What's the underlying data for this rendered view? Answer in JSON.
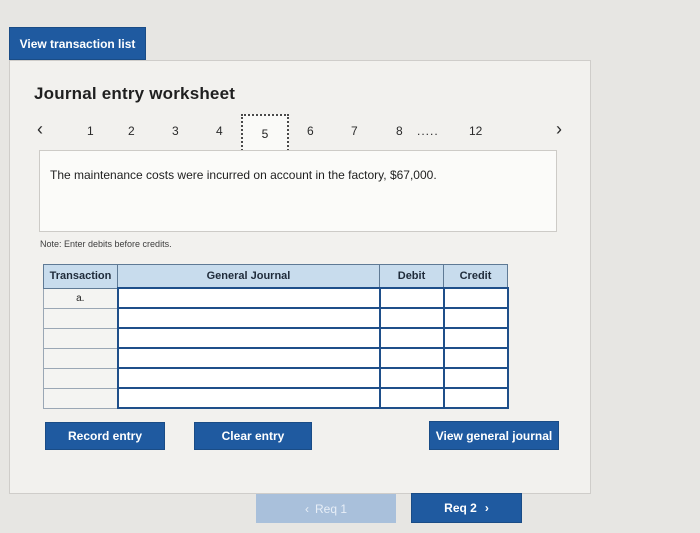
{
  "top_button": {
    "label": "View transaction list"
  },
  "worksheet": {
    "title": "Journal entry worksheet",
    "nav": {
      "items": [
        "1",
        "2",
        "3",
        "4",
        "5",
        "6",
        "7",
        "8",
        "12"
      ],
      "current": "5",
      "ellipsis": "....."
    },
    "description": "The maintenance costs were incurred on account in the factory, $67,000.",
    "note": "Note: Enter debits before credits.",
    "table": {
      "headers": [
        "Transaction",
        "General Journal",
        "Debit",
        "Credit"
      ],
      "rows": [
        [
          "a.",
          "",
          "",
          ""
        ],
        [
          "",
          "",
          "",
          ""
        ],
        [
          "",
          "",
          "",
          ""
        ],
        [
          "",
          "",
          "",
          ""
        ],
        [
          "",
          "",
          "",
          ""
        ],
        [
          "",
          "",
          "",
          ""
        ]
      ]
    },
    "buttons": {
      "record": "Record entry",
      "clear": "Clear entry",
      "view_journal": "View general journal"
    }
  },
  "footer": {
    "prev": "Req 1",
    "next": "Req 2"
  },
  "colors": {
    "primary": "#1f5aa0",
    "header_bg": "#c8dced",
    "disabled": "#a9c0db"
  }
}
